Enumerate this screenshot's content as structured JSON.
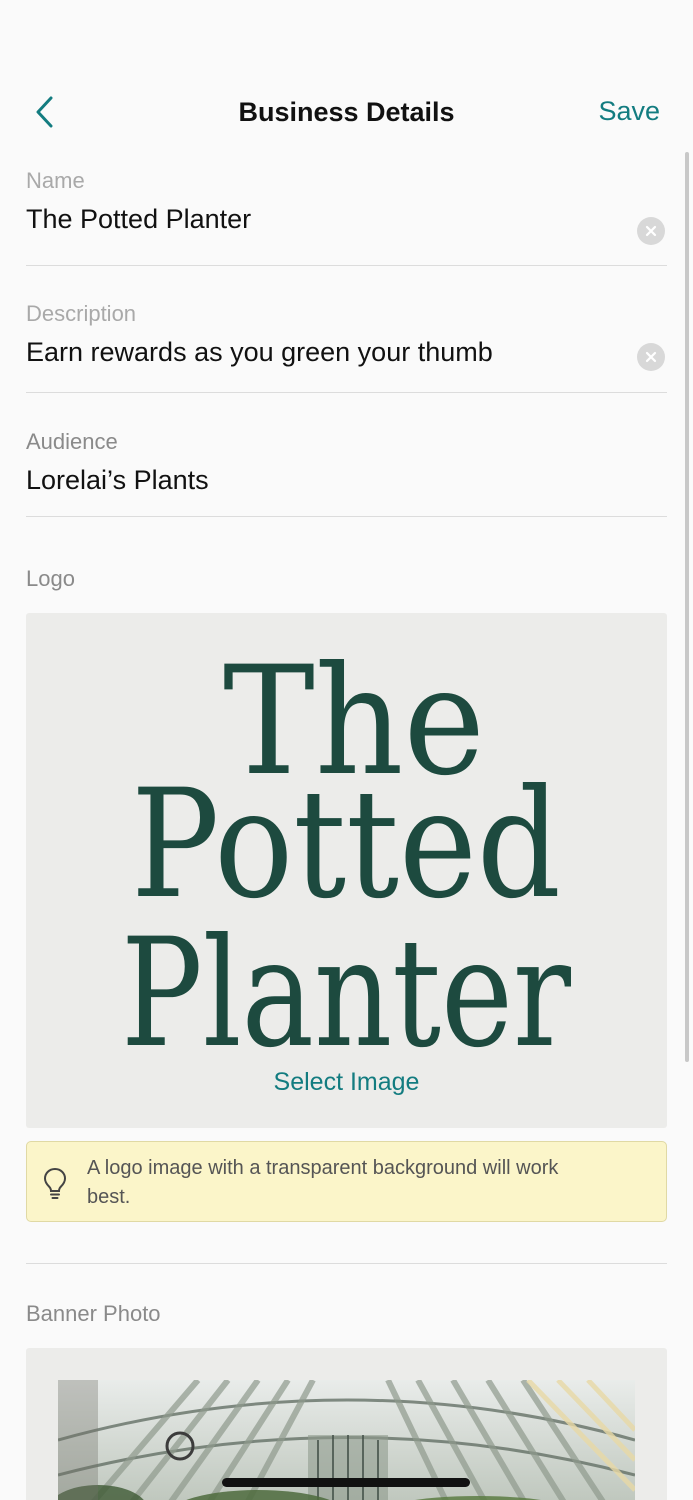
{
  "nav": {
    "back_icon": "chevron-left-icon",
    "title": "Business Details",
    "save_label": "Save"
  },
  "form": {
    "name": {
      "label": "Name",
      "value": "The Potted Planter",
      "clear_icon": "clear-icon"
    },
    "description": {
      "label": "Description",
      "value": "Earn rewards as you green your thumb",
      "clear_icon": "clear-icon"
    },
    "audience": {
      "label": "Audience",
      "value": "Lorelai’s Plants"
    }
  },
  "logo": {
    "label": "Logo",
    "wordmark_lines": [
      "The",
      "Potted",
      "Planter"
    ],
    "select_label": "Select Image"
  },
  "tip": {
    "icon": "lightbulb-icon",
    "text": "A logo image with a transparent background will work best."
  },
  "banner": {
    "label": "Banner Photo"
  },
  "colors": {
    "accent": "#137c80",
    "logo_green": "#1d4a3f",
    "tip_background": "#fbf5c9"
  }
}
